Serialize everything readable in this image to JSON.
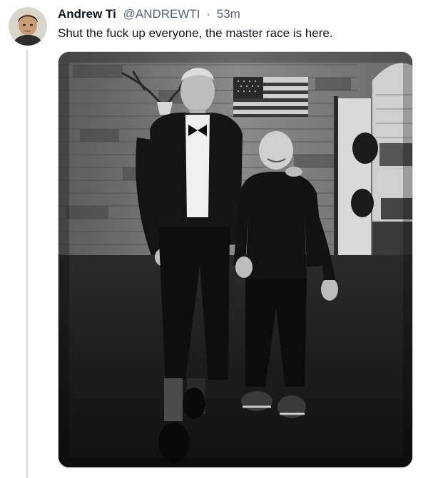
{
  "tweet": {
    "author_name": "Andrew Ti",
    "handle": "@ANDREWTI",
    "separator": "·",
    "time": "53m",
    "text": "Shut the fuck up everyone, the master race is here."
  },
  "avatar": {
    "icon": "user-avatar"
  },
  "media": {
    "type": "photo",
    "style": "black-and-white"
  },
  "colors": {
    "text": "#0f1419",
    "secondary": "#536471",
    "border": "#cfd9de",
    "background": "#ffffff"
  }
}
